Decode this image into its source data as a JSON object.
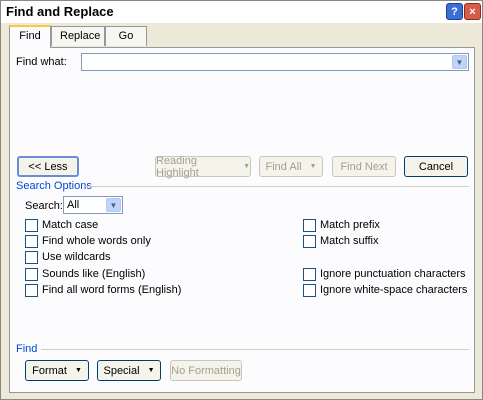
{
  "window": {
    "title": "Find and Replace",
    "help_glyph": "?",
    "close_glyph": "×"
  },
  "tabs": [
    {
      "label": "Find",
      "active": true
    },
    {
      "label": "Replace",
      "active": false
    },
    {
      "label": "Go To",
      "active": false
    }
  ],
  "find": {
    "label": "Find what:",
    "value": "",
    "dropdown_icon": "chevron-down-icon"
  },
  "buttons": {
    "less": "<< Less",
    "reading_highlight": "Reading Highlight",
    "find_all": "Find All",
    "find_next": "Find Next",
    "cancel": "Cancel",
    "format": "Format",
    "special": "Special",
    "no_formatting": "No Formatting"
  },
  "search_options": {
    "title": "Search Options",
    "search_label": "Search:",
    "search_value": "All",
    "left_options": [
      {
        "label": "Match case",
        "checked": false
      },
      {
        "label": "Find whole words only",
        "checked": false
      },
      {
        "label": "Use wildcards",
        "checked": false
      },
      {
        "label": "Sounds like (English)",
        "checked": false
      },
      {
        "label": "Find all word forms (English)",
        "checked": false
      }
    ],
    "right_options": [
      {
        "label": "Match prefix",
        "checked": false
      },
      {
        "label": "Match suffix",
        "checked": false
      },
      {
        "label": "Ignore punctuation characters",
        "checked": false
      },
      {
        "label": "Ignore white-space characters",
        "checked": false
      }
    ]
  },
  "find_section": {
    "title": "Find"
  },
  "colors": {
    "accent": "#0046d5",
    "dialog_bg": "#ece9d8",
    "tab_highlight": "#ffc73c"
  }
}
